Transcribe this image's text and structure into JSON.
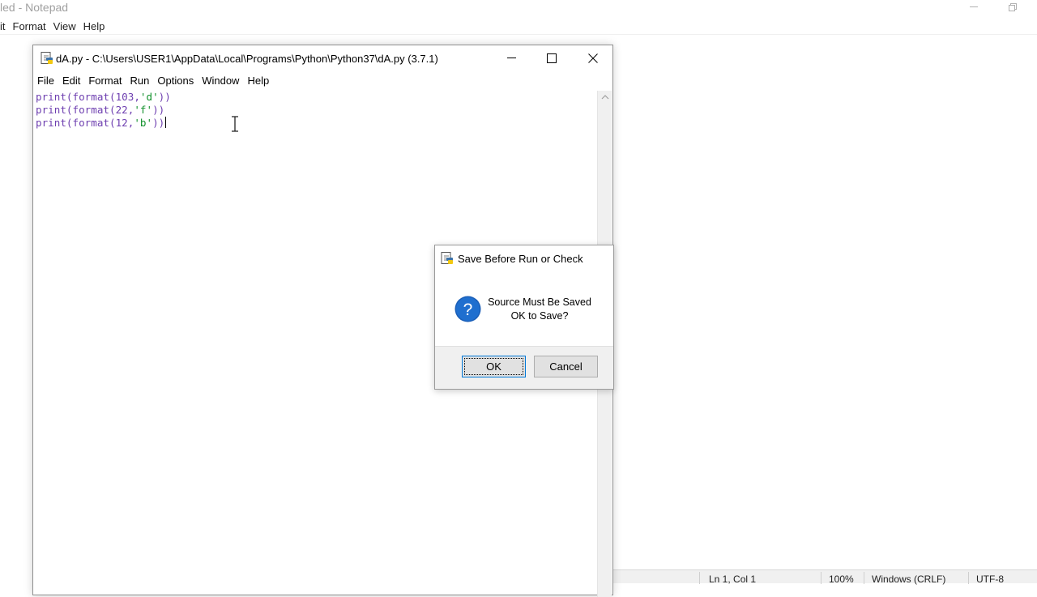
{
  "notepad": {
    "title": "led - Notepad",
    "menu": [
      "it",
      "Format",
      "View",
      "Help"
    ],
    "status": {
      "position": "Ln 1, Col 1",
      "zoom": "100%",
      "line_ending": "Windows (CRLF)",
      "encoding": "UTF-8"
    }
  },
  "editor": {
    "title": "dA.py - C:\\Users\\USER1\\AppData\\Local\\Programs\\Python\\Python37\\dA.py (3.7.1)",
    "menu": [
      "File",
      "Edit",
      "Format",
      "Run",
      "Options",
      "Window",
      "Help"
    ],
    "lines": [
      {
        "pre": "print(format(103,",
        "str": "'d'",
        "post": "))"
      },
      {
        "pre": "print(format(22,",
        "str": "'f'",
        "post": "))"
      },
      {
        "pre": "print(format(12,",
        "str": "'b'",
        "post": "))"
      }
    ]
  },
  "dialog": {
    "title": "Save Before Run or Check",
    "message_line1": "Source Must Be Saved",
    "message_line2": "OK to Save?",
    "ok_label": "OK",
    "cancel_label": "Cancel"
  },
  "colors": {
    "builtin": "#6e3fb0",
    "string": "#10902a",
    "accent": "#0078d7"
  }
}
